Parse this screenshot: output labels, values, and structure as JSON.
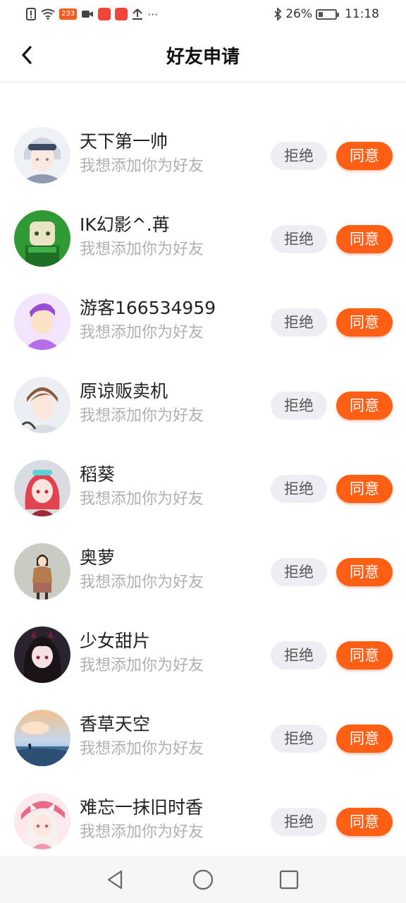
{
  "status_bar": {
    "badge_text": "233",
    "battery_percent": "26%",
    "time": "11:18",
    "battery_level": 0.26
  },
  "header": {
    "title": "好友申请"
  },
  "requests": {
    "subtitle": "我想添加你为好友",
    "reject_label": "拒绝",
    "accept_label": "同意",
    "items": [
      {
        "name": ""
      },
      {
        "name": "天下第一帅"
      },
      {
        "name": "IK幻影^.苒"
      },
      {
        "name": "游客166534959"
      },
      {
        "name": "原谅贩卖机"
      },
      {
        "name": "稻葵"
      },
      {
        "name": "奥萝"
      },
      {
        "name": "少女甜片"
      },
      {
        "name": "香草天空"
      },
      {
        "name": "难忘一抹旧时香"
      }
    ]
  },
  "colors": {
    "accent": "#ff5f14",
    "reject_bg": "#eeedf3",
    "subtitle": "#b0b0b0"
  }
}
